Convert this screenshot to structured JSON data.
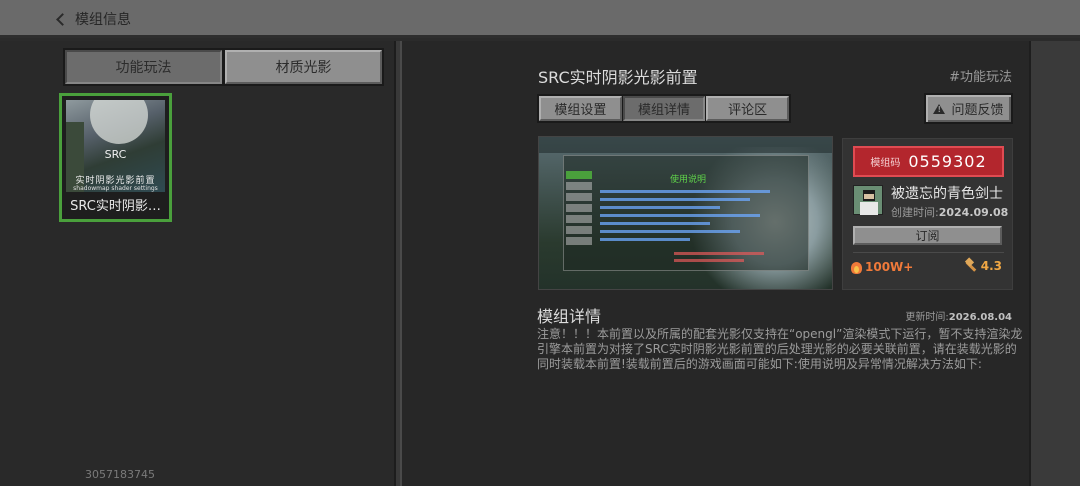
{
  "header": {
    "back_label": "模组信息"
  },
  "left": {
    "tabs": [
      {
        "label": "功能玩法"
      },
      {
        "label": "材质光影"
      }
    ],
    "card": {
      "thumb_title": "SRC",
      "thumb_subtitle": "实时阴影光影前置",
      "thumb_caption": "shadowmap shader settings",
      "name": "SRC实时阴影…"
    },
    "user_id": "3057183745"
  },
  "detail": {
    "title": "SRC实时阴影光影前置",
    "tag": "#功能玩法",
    "tabs": [
      {
        "label": "模组设置"
      },
      {
        "label": "模组详情"
      },
      {
        "label": "评论区"
      }
    ],
    "feedback_label": "问题反馈",
    "preview_heading": "使用说明",
    "info": {
      "code_label": "模组码",
      "code_value": "0559302",
      "author": "被遗忘的青色剑士",
      "created_label": "创建时间:",
      "created_value": "2024.09.08",
      "subscribe_label": "订阅",
      "heat": "100W+",
      "rating": "4.3"
    },
    "section_title": "模组详情",
    "update_label": "更新时间:",
    "update_value": "2026.08.04",
    "description": "注意！！！本前置以及所属的配套光影仅支持在“opengl”渲染模式下运行，暂不支持渲染龙引擎本前置为对接了SRC实时阴影光影前置的后处理光影的必要关联前置，请在装载光影的同时装载本前置!装载前置后的游戏画面可能如下:使用说明及异常情况解决方法如下:"
  },
  "colors": {
    "selected_border": "#4aa03c",
    "code_bg": "#b3262d",
    "heat": "#f07a3a",
    "rating": "#f0a744"
  },
  "icons": [
    "back-chevron-icon",
    "warning-icon",
    "fire-icon",
    "hammer-icon"
  ]
}
